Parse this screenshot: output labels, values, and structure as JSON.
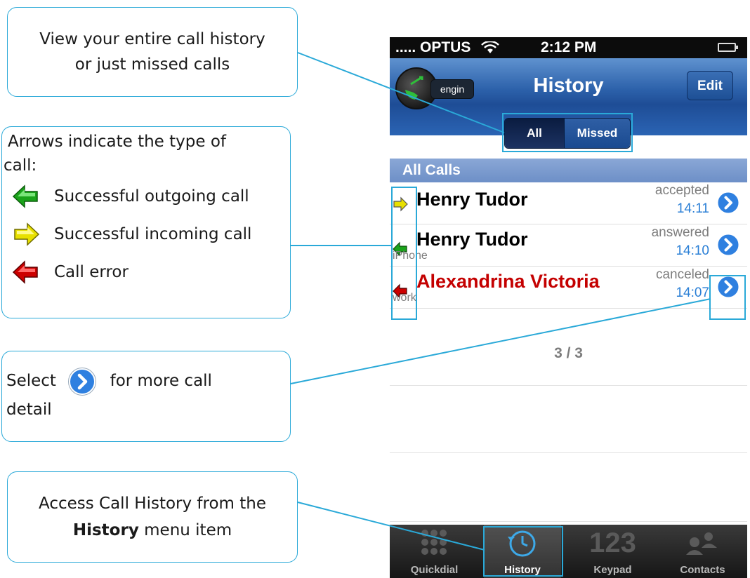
{
  "callouts": {
    "history_view": {
      "line1": "View your entire call history",
      "line2": "or just missed calls"
    },
    "arrows": {
      "intro_line1": "Arrows indicate the type of",
      "intro_line2": "call:",
      "legend": [
        {
          "label": "Successful outgoing call",
          "color": "#1aa31a",
          "icon": "green-arrow-icon"
        },
        {
          "label": "Successful incoming call",
          "color": "#e8e000",
          "icon": "yellow-arrow-icon"
        },
        {
          "label": "Call error",
          "color": "#cc0000",
          "icon": "red-arrow-icon"
        }
      ]
    },
    "detail": {
      "select": "Select",
      "for_more": "for more call",
      "detail": "detail"
    },
    "menu": {
      "line1": "Access Call History from the",
      "bold": "History",
      "rest": " menu item"
    }
  },
  "phone": {
    "status": {
      "carrier": "..... OPTUS",
      "time": "2:12 PM"
    },
    "nav": {
      "title": "History",
      "edit": "Edit",
      "logo_badge": "engin"
    },
    "segments": {
      "all": "All",
      "missed": "Missed"
    },
    "section_header": "All Calls",
    "calls": [
      {
        "name": "Henry Tudor",
        "sub": "",
        "status": "accepted",
        "time": "14:11",
        "type": "incoming",
        "name_color": "#000000"
      },
      {
        "name": "Henry Tudor",
        "sub": "iPhone",
        "status": "answered",
        "time": "14:10",
        "type": "outgoing",
        "name_color": "#000000"
      },
      {
        "name": "Alexandrina Victoria",
        "sub": "work",
        "status": "canceled",
        "time": "14:07",
        "type": "error",
        "name_color": "#c40000"
      }
    ],
    "count": "3 / 3",
    "tabs": [
      {
        "label": "Quickdial",
        "icon": "grid-icon",
        "selected": false
      },
      {
        "label": "History",
        "icon": "clock-icon",
        "selected": true
      },
      {
        "label": "Keypad",
        "icon": "keypad-123-icon",
        "selected": false
      },
      {
        "label": "Contacts",
        "icon": "contacts-icon",
        "selected": false
      }
    ],
    "keypad_icon_text": "123"
  },
  "colors": {
    "accent": "#2aa9d8",
    "nav_blue": "#2d62ab",
    "link_blue": "#2a7fd6",
    "error_red": "#c40000"
  }
}
